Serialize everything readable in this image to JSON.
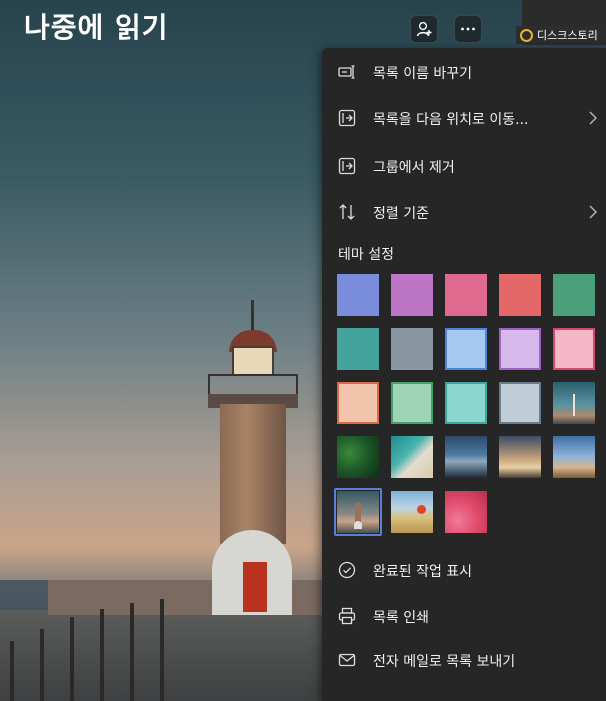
{
  "page": {
    "title": "나중에 읽기"
  },
  "header": {
    "add_member_icon": "person-add-icon",
    "more_icon": "more-horizontal-icon"
  },
  "browser_tab": {
    "label": "디스크스토리"
  },
  "menu": {
    "items_top": [
      {
        "label": "목록 이름 바꾸기",
        "icon": "rename-icon"
      },
      {
        "label": "목록을 다음 위치로 이동...",
        "icon": "move-list-icon",
        "has_submenu": true
      },
      {
        "label": "그룹에서 제거",
        "icon": "remove-from-group-icon"
      },
      {
        "label": "정렬 기준",
        "icon": "sort-icon",
        "has_submenu": true
      }
    ],
    "theme_section_label": "테마 설정",
    "swatch_colors": [
      "#7a8cdc",
      "#bd76c6",
      "#e06a8f",
      "#e56868",
      "#4aa07a",
      "#44a39c",
      "#8a96a0",
      "#a6c8f0",
      "#d9b8ec",
      "#f5b6c8",
      "#f2c4ac",
      "#9ed5b8",
      "#8bd6d0",
      "#c0ccd6"
    ],
    "swatch_borders": [
      "",
      "",
      "",
      "",
      "",
      "",
      "",
      "#4c84d8",
      "#9b62c2",
      "#d4486e",
      "#d86a45",
      "#45a06a",
      "#3ea79c",
      "#6a7d8c"
    ],
    "selected_theme_index": 20,
    "items_bottom": [
      {
        "label": "완료된 작업 표시",
        "icon": "check-circle-icon"
      },
      {
        "label": "목록 인쇄",
        "icon": "printer-icon"
      },
      {
        "label": "전자 메일로 목록 보내기",
        "icon": "mail-icon"
      }
    ]
  }
}
